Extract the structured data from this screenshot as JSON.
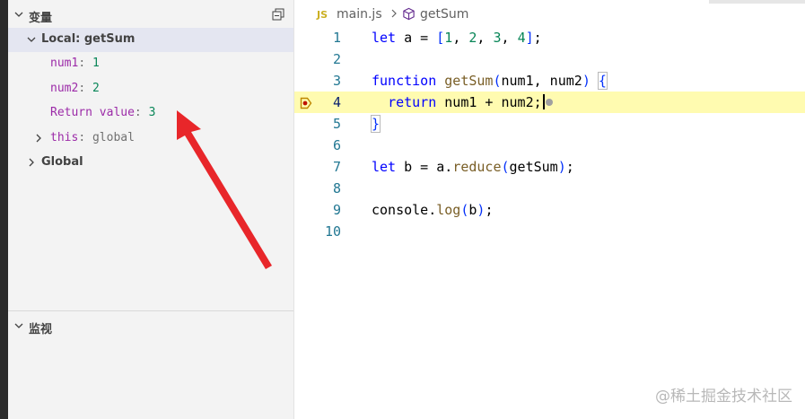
{
  "sidebar": {
    "variables_title": "变量",
    "watch_title": "监视",
    "local_scope": "Local: getSum",
    "global_scope": "Global",
    "variables": [
      {
        "name": "num1",
        "value": "1"
      },
      {
        "name": "num2",
        "value": "2"
      },
      {
        "name": "Return value",
        "value": "3"
      },
      {
        "name": "this",
        "value": "global"
      }
    ]
  },
  "editor": {
    "file_badge": "JS",
    "file_name": "main.js",
    "symbol_name": "getSum",
    "line_numbers": [
      "1",
      "2",
      "3",
      "4",
      "5",
      "6",
      "7",
      "8",
      "9",
      "10"
    ],
    "lines": {
      "l1_kw": "let",
      "l1_a": " a = ",
      "l1_open": "[",
      "l1_n1": "1",
      "l1_c1": ", ",
      "l1_n2": "2",
      "l1_c2": ", ",
      "l1_n3": "3",
      "l1_c3": ", ",
      "l1_n4": "4",
      "l1_close": "]",
      "l1_end": ";",
      "l3_kw": "function",
      "l3_sp": " ",
      "l3_fn": "getSum",
      "l3_open": "(",
      "l3_params": "num1, num2",
      "l3_close": ")",
      "l3_sp2": " ",
      "l3_brace": "{",
      "l4_indent": "  ",
      "l4_kw": "return",
      "l4_rest": " num1 + num2;",
      "l5_brace": "}",
      "l7_kw": "let",
      "l7_a": " b = a.",
      "l7_fn": "reduce",
      "l7_open": "(",
      "l7_arg": "getSum",
      "l7_close": ")",
      "l7_end": ";",
      "l9_a": "console.",
      "l9_fn": "log",
      "l9_open": "(",
      "l9_arg": "b",
      "l9_close": ")",
      "l9_end": ";"
    }
  },
  "watermark": "@稀土掘金技术社区",
  "colors": {
    "arrow": "#e8262a",
    "current_line": "#fffbb0",
    "debug_pointer": "#be1100"
  }
}
